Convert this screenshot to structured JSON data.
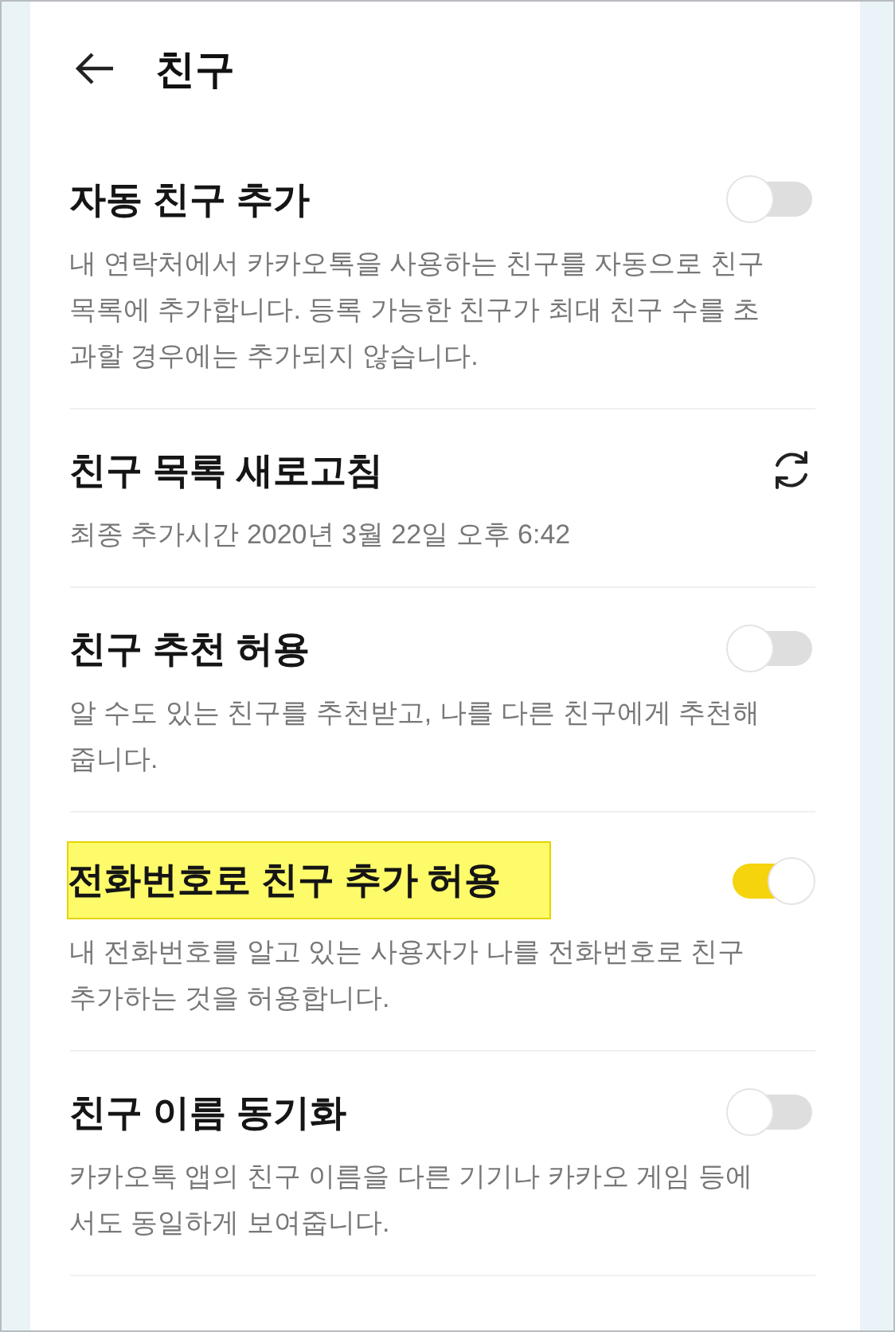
{
  "header": {
    "title": "친구"
  },
  "settings": [
    {
      "kind": "toggle",
      "title": "자동 친구 추가",
      "highlighted": false,
      "on": false,
      "description": "내 연락처에서 카카오톡을 사용하는 친구를 자동으로 친구목록에 추가합니다. 등록 가능한 친구가 최대 친구 수를 초과할 경우에는 추가되지 않습니다."
    },
    {
      "kind": "refresh",
      "title": "친구 목록 새로고침",
      "highlighted": false,
      "description": "최종 추가시간 2020년 3월 22일 오후 6:42"
    },
    {
      "kind": "toggle",
      "title": "친구 추천 허용",
      "highlighted": false,
      "on": false,
      "description": "알 수도 있는 친구를 추천받고, 나를 다른 친구에게 추천해줍니다."
    },
    {
      "kind": "toggle",
      "title": "전화번호로 친구 추가 허용",
      "highlighted": true,
      "on": true,
      "description": "내 전화번호를 알고 있는 사용자가 나를 전화번호로 친구 추가하는 것을 허용합니다."
    },
    {
      "kind": "toggle",
      "title": "친구 이름 동기화",
      "highlighted": false,
      "on": false,
      "description": "카카오톡 앱의 친구 이름을 다른 기기나 카카오 게임 등에서도 동일하게 보여줍니다."
    }
  ]
}
